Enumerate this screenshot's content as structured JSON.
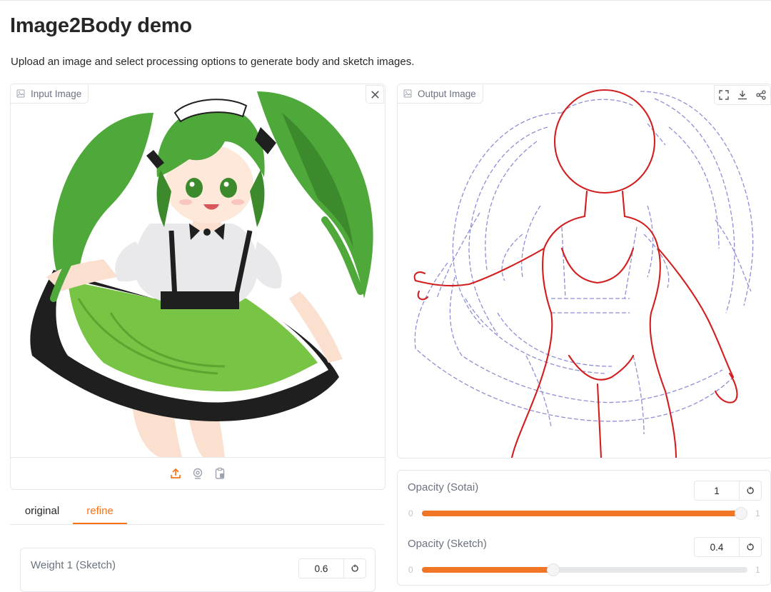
{
  "app": {
    "title": "Image2Body demo",
    "description": "Upload an image and select processing options to generate body and sketch images."
  },
  "input_panel": {
    "label": "Input Image",
    "icons": [
      "image-icon",
      "close-icon",
      "upload-icon",
      "webcam-icon",
      "clipboard-icon"
    ]
  },
  "output_panel": {
    "label": "Output Image",
    "icons": [
      "image-icon",
      "fullscreen-icon",
      "download-icon",
      "share-icon"
    ]
  },
  "tabs": [
    {
      "label": "original",
      "selected": false
    },
    {
      "label": "refine",
      "selected": true
    }
  ],
  "sliders": {
    "opacity_sotai": {
      "label": "Opacity (Sotai)",
      "value": "1",
      "min": "0",
      "max": "1",
      "fraction": 1.0
    },
    "opacity_sketch": {
      "label": "Opacity (Sketch)",
      "value": "0.4",
      "min": "0",
      "max": "1",
      "fraction": 0.4
    },
    "weight1_sketch": {
      "label": "Weight 1 (Sketch)",
      "value": "0.6"
    }
  },
  "colors": {
    "accent": "#f97316",
    "slider_fill": "#f07524",
    "sketch_line": "#8f8fd6",
    "body_line": "#d21e1e",
    "hair_green": "#4fa83a"
  }
}
